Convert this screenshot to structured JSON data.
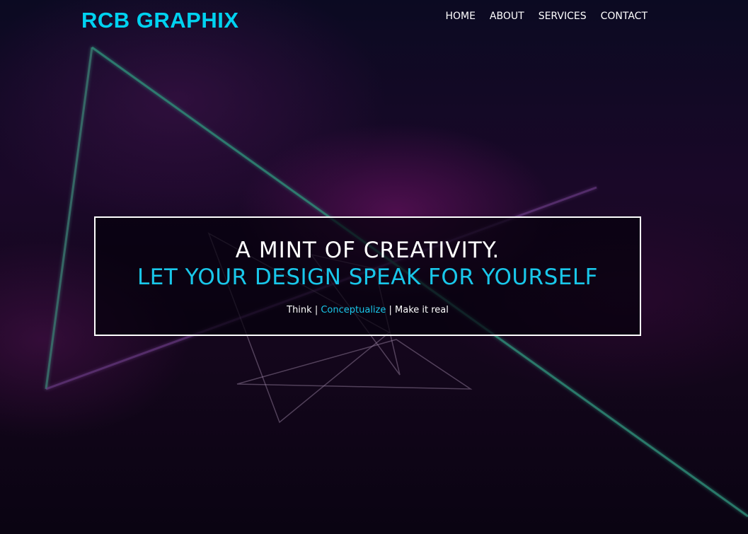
{
  "brand": {
    "name": "RCB GRAPHIX"
  },
  "nav": {
    "items": [
      {
        "label": "HOME"
      },
      {
        "label": "ABOUT"
      },
      {
        "label": "SERVICES"
      },
      {
        "label": "CONTACT"
      }
    ]
  },
  "hero": {
    "line1": "A MINT OF CREATIVITY.",
    "line2": "LET YOUR DESIGN SPEAK FOR YOURSELF",
    "tagline": {
      "part1": "Think",
      "sep1": " | ",
      "part2": "Conceptualize",
      "sep2": " | ",
      "part3": "Make it real"
    }
  },
  "colors": {
    "accent": "#19c7ea",
    "brand": "#00d2f0",
    "text": "#ffffff",
    "background": "#14061c"
  }
}
